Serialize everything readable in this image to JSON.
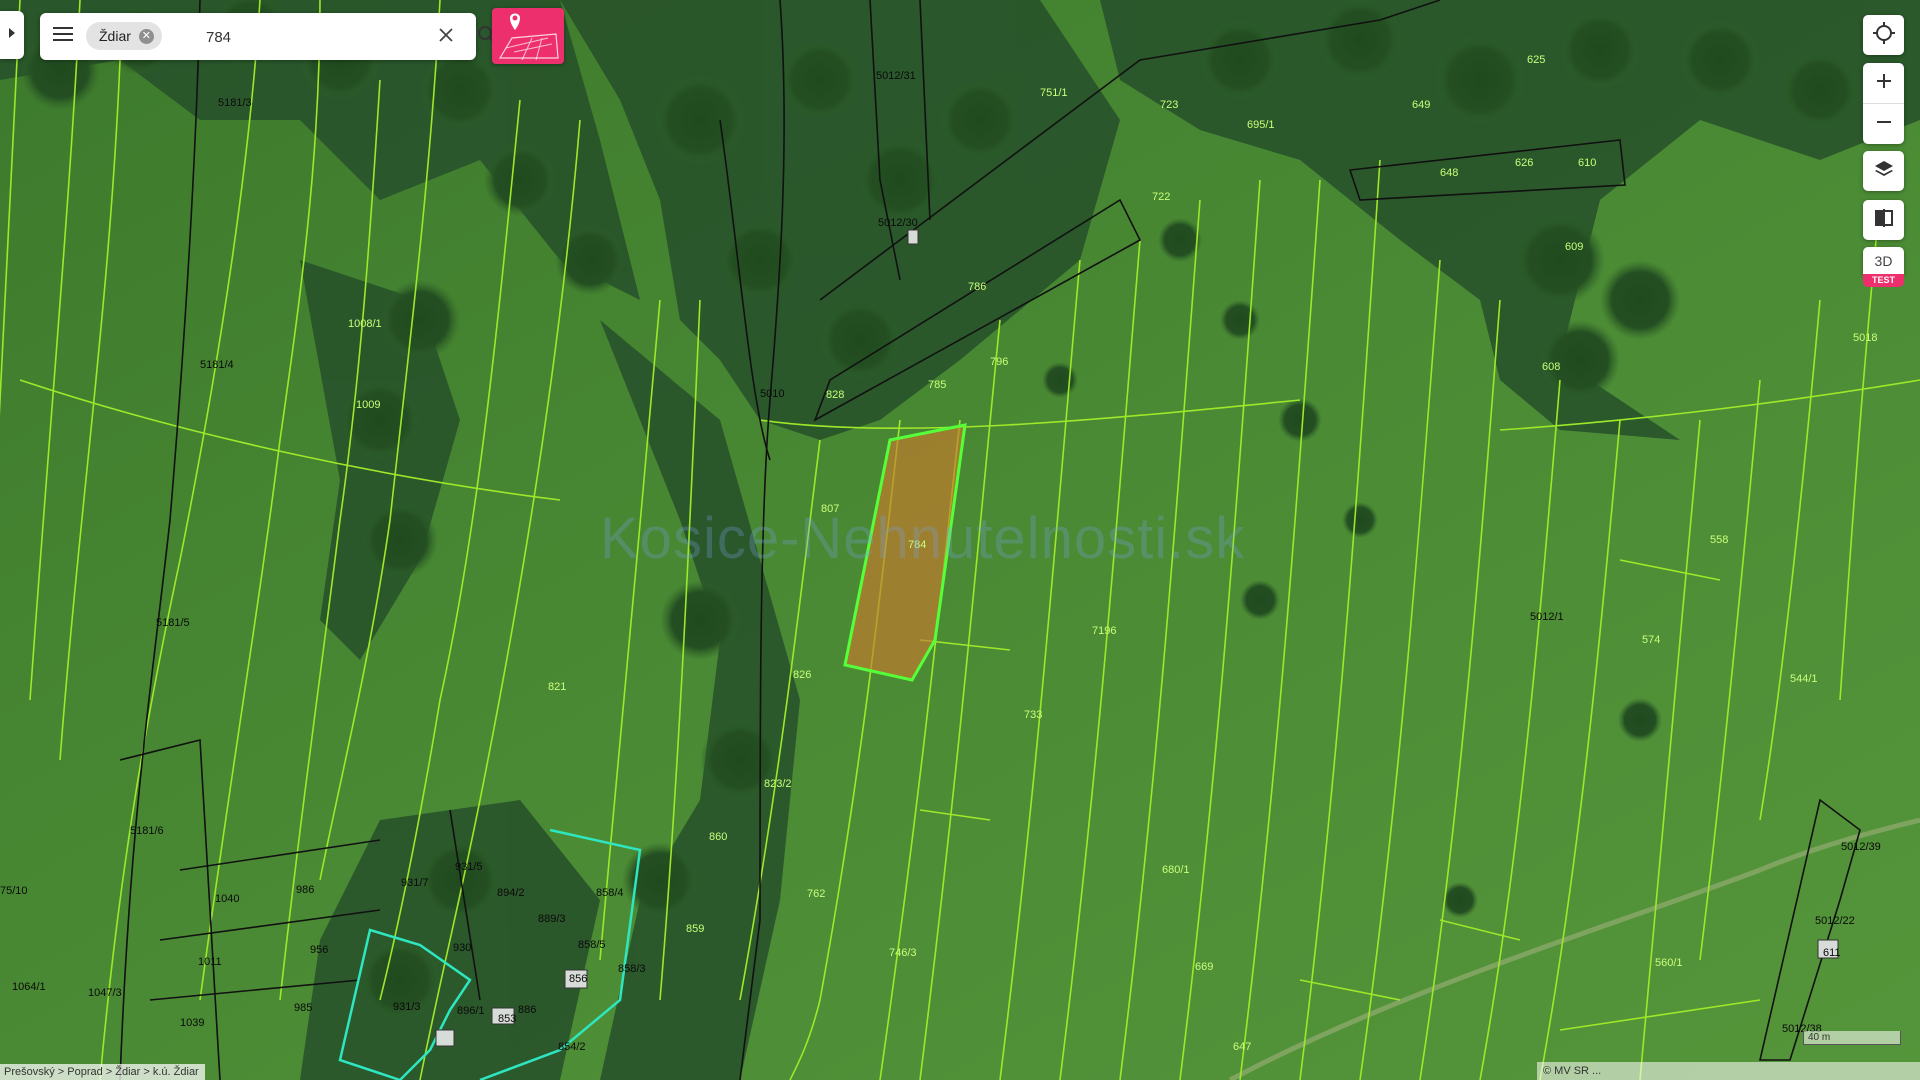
{
  "search": {
    "chip_label": "Ždiar",
    "query": "784",
    "placeholder": ""
  },
  "controls": {
    "btn_3d": "3D",
    "test_badge": "TEST"
  },
  "breadcrumb": "Prešovský > Poprad > Ždiar > k.ú. Ždiar",
  "attribution": "© MV SR ...",
  "scale_label": "40 m",
  "watermark": "Kosice-Nehnutelnosti.sk",
  "colors": {
    "accent_pink": "#ee2f6e",
    "parcel_line": "#9ee82a",
    "selected_fill": "#c97b2c",
    "selected_outline": "#55ff3a",
    "building_outline": "#2ee6c0"
  },
  "icons": {
    "menu": "hamburger-icon",
    "clear": "close-icon",
    "search": "search-icon",
    "locate": "crosshair-icon",
    "zoom_in": "plus-icon",
    "zoom_out": "minus-icon",
    "layers": "layers-icon",
    "compare": "split-view-icon",
    "parcel_pin": "parcel-pin-icon"
  },
  "parcel_labels": [
    "5181/3",
    "5181/4",
    "5181/5",
    "5181/6",
    "5012/31",
    "5012/30",
    "5012/1",
    "5012/39",
    "5012/22",
    "5012/38",
    "785",
    "784",
    "786",
    "796",
    "828",
    "826",
    "807",
    "860",
    "859",
    "823/2",
    "858/4",
    "858/5",
    "858/3",
    "889/3",
    "894/2",
    "931/5",
    "931/7",
    "931/3",
    "930",
    "896/1",
    "886",
    "856",
    "853",
    "854/2",
    "1040",
    "1011",
    "1039",
    "986",
    "956",
    "985",
    "1064/1",
    "1047/3",
    "75/10",
    "649",
    "648",
    "626",
    "610",
    "609",
    "608",
    "625",
    "695/1",
    "723",
    "722",
    "751/1",
    "7196",
    "558",
    "574",
    "544/1",
    "560/1",
    "611",
    "647",
    "669",
    "680/1",
    "746/3",
    "733",
    "762",
    "5010",
    "1008/1",
    "1009",
    "821",
    "5018"
  ]
}
